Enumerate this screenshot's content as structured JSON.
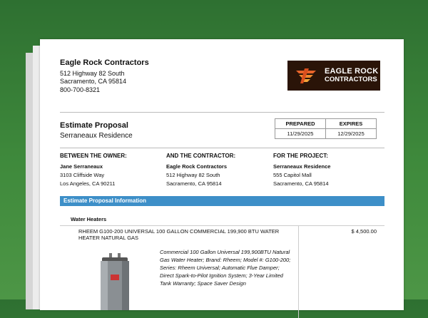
{
  "company": {
    "name": "Eagle Rock Contractors",
    "address1": "512 Highway 82 South",
    "address2": "Sacramento, CA 95814",
    "phone": "800-700-8321"
  },
  "logo": {
    "line1": "EAGLE ROCK",
    "line2": "CONTRACTORS"
  },
  "proposal": {
    "title": "Estimate Proposal",
    "subtitle": "Serraneaux Residence"
  },
  "dates": {
    "prepared_label": "PREPARED",
    "prepared_value": "11/29/2025",
    "expires_label": "EXPIRES",
    "expires_value": "12/29/2025"
  },
  "parties": {
    "owner": {
      "heading": "BETWEEN THE OWNER:",
      "name": "Jane Serraneaux",
      "line1": "3103 Cliffside Way",
      "line2": "Los Angeles, CA 90211"
    },
    "contractor": {
      "heading": "AND THE CONTRACTOR:",
      "name": "Eagle Rock Contractors",
      "line1": "512 Highway 82 South",
      "line2": "Sacramento, CA 95814"
    },
    "project": {
      "heading": "FOR THE PROJECT:",
      "name": "Serraneaux Residence",
      "line1": "555 Capitol Mall",
      "line2": "Sacramento, CA 95814"
    }
  },
  "section_bar": "Estimate Proposal Information",
  "category": "Water Heaters",
  "item": {
    "title": "RHEEM G100-200 UNIVERSAL 100 GALLON COMMERCIAL 199,900 BTU WATER HEATER NATURAL GAS",
    "price": "$ 4,500.00",
    "description": "Commercial 100 Gallon Universal 199,900BTU Natural Gas Water Heater; Brand: Rheem; Model #: G100-200; Series: Rheem Universal; Automatic Flue Damper; Direct Spark-to-Pilot Ignition System; 3-Year Limited Tank Warranty; Space Saver Design"
  },
  "colors": {
    "background": "#3f8a3c",
    "bar": "#3d8fc8",
    "logo_bg": "#2a1408",
    "logo_accent": "#e8642a"
  }
}
